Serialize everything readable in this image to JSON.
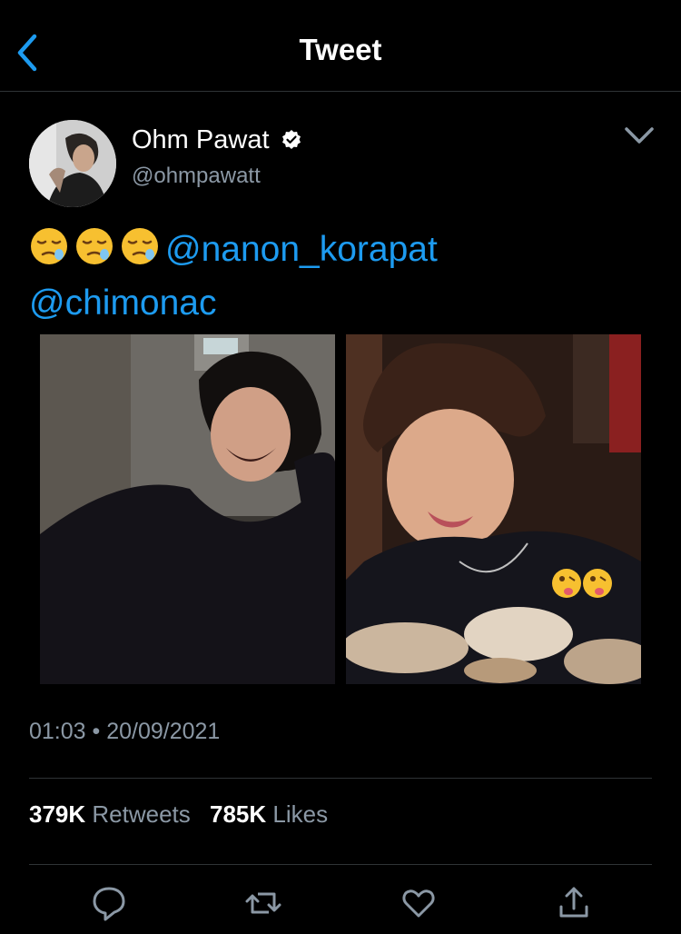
{
  "header": {
    "title": "Tweet"
  },
  "author": {
    "display_name": "Ohm Pawat",
    "handle": "@ohmpawatt"
  },
  "tweet": {
    "emojis": [
      "sleepy-face",
      "sleepy-face",
      "sleepy-face"
    ],
    "mention_1": "@nanon_korapat",
    "mention_2": "@chimonac",
    "timestamp": "01:03 • 20/09/2021"
  },
  "media": [
    {
      "name": "photo-laughing-man"
    },
    {
      "name": "photo-man-with-scallops",
      "overlay_emojis": [
        "winking-face-with-tongue",
        "winking-face-with-tongue"
      ]
    }
  ],
  "stats": {
    "retweets_count": "379K",
    "retweets_label": "Retweets",
    "likes_count": "785K",
    "likes_label": "Likes"
  },
  "actions": [
    "reply-icon",
    "retweet-icon",
    "like-icon",
    "share-icon"
  ],
  "colors": {
    "accent": "#1d9bf0",
    "background": "#000000",
    "secondary_text": "#8b98a5",
    "divider": "#2f3336"
  }
}
